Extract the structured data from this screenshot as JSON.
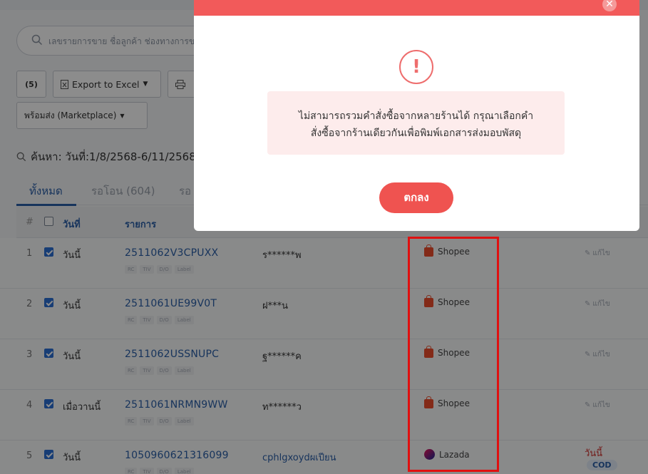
{
  "search": {
    "placeholder": "เลขรายการขาย ชื่อลูกค้า ช่องทางการข"
  },
  "toolbar": {
    "count_label": "(5)",
    "export_label": "Export to Excel",
    "ready_label": "พร้อมส่ง (Marketplace)"
  },
  "query": {
    "text": "ค้นหา: วันที่:1/8/2568-6/11/2568"
  },
  "tabs": [
    {
      "label": "ทั้งหมด"
    },
    {
      "label": "รอโอน (604)"
    },
    {
      "label": "รอ"
    }
  ],
  "table": {
    "headers": {
      "num": "#",
      "date": "วันที่",
      "order": "รายการ"
    },
    "tag_labels": [
      "RC",
      "TIV",
      "D/O",
      "Label"
    ],
    "edit_label": "แก้ไข",
    "rows": [
      {
        "num": "1",
        "date": "วันนี้",
        "order": "2511062V3CPUXX",
        "customer": "ร******พ",
        "channel": "Shopee"
      },
      {
        "num": "2",
        "date": "วันนี้",
        "order": "2511061UE99V0T",
        "customer": "ฝ***น",
        "channel": "Shopee"
      },
      {
        "num": "3",
        "date": "วันนี้",
        "order": "2511062USSNUPC",
        "customer": "ฐ******ค",
        "channel": "Shopee"
      },
      {
        "num": "4",
        "date": "เมื่อวานนี้",
        "order": "2511061NRMN9WW",
        "customer": "ท******ว",
        "channel": "Shopee"
      },
      {
        "num": "5",
        "date": "วันนี้",
        "order": "1050960621316099",
        "customer": "cphlgxoydผเปียน",
        "channel": "Lazada",
        "status": "วันนี้",
        "payment": "COD"
      }
    ]
  },
  "modal": {
    "icon": "exclamation-icon",
    "message_line1": "ไม่สามารถรวมคำสั่งซื้อจากหลายร้านได้ กรุณาเลือกคำ",
    "message_line2": "สั่งซื้อจากร้านเดียวกันเพื่อพิมพ์เอกสารส่งมอบพัสดุ",
    "ok_label": "ตกลง",
    "close_symbol": "✕"
  },
  "colors": {
    "accent": "#2b5fa8",
    "modal_header": "#f25a5a",
    "ok_button": "#ef5350",
    "highlight_box": "#e01010"
  }
}
